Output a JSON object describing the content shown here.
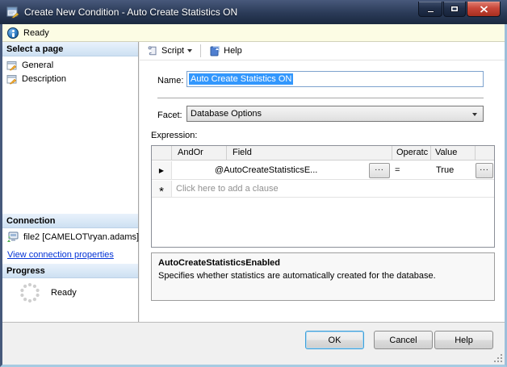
{
  "window": {
    "title": "Create New Condition - Auto Create Statistics ON"
  },
  "statusbar": {
    "text": "Ready"
  },
  "sidebar": {
    "pages_header": "Select a page",
    "pages": [
      {
        "label": "General"
      },
      {
        "label": "Description"
      }
    ],
    "connection_header": "Connection",
    "connection_name": "file2 [CAMELOT\\ryan.adams]",
    "connection_link": "View connection properties",
    "progress_header": "Progress",
    "progress_status": "Ready"
  },
  "toolbar": {
    "script": "Script",
    "help": "Help"
  },
  "form": {
    "name_label": "Name:",
    "name_value": "Auto Create Statistics ON",
    "facet_label": "Facet:",
    "facet_value": "Database Options",
    "expression_label": "Expression:"
  },
  "expression_grid": {
    "headers": {
      "andor": "AndOr",
      "field": "Field",
      "operator": "Operatc",
      "value": "Value"
    },
    "row": {
      "marker": "▶",
      "field": "@AutoCreateStatisticsE...",
      "field_button": "...",
      "operator": "=",
      "value": "True",
      "value_button": "..."
    },
    "new_row": {
      "marker": "*",
      "placeholder": "Click here to add a clause"
    }
  },
  "description_panel": {
    "title": "AutoCreateStatisticsEnabled",
    "text": "Specifies whether statistics are automatically created for the database."
  },
  "footer": {
    "ok": "OK",
    "cancel": "Cancel",
    "help": "Help"
  },
  "colors": {
    "titlebar": "#2a3a57",
    "status_bg": "#fcfce4",
    "section_header_bg": "#cde0f2",
    "selection": "#3297fd",
    "link": "#0433d6",
    "close_button": "#c8473a"
  }
}
